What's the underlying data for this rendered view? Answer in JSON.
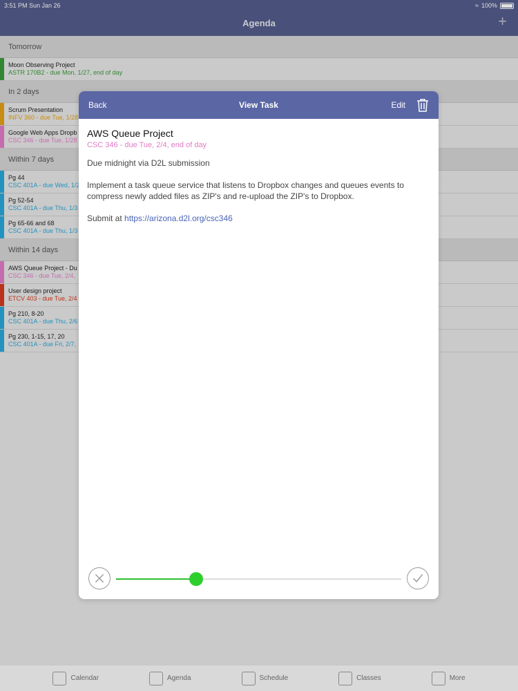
{
  "status": {
    "time": "3:51 PM  Sun Jan 26",
    "battery": "100%"
  },
  "nav": {
    "title": "Agenda",
    "add_label": "+"
  },
  "list": {
    "sections": [
      {
        "title": "Tomorrow",
        "items": [
          {
            "title": "Moon Observing Project",
            "sub": "ASTR 170B2 - due Mon, 1/27, end of day",
            "color": "#3a9b3a"
          }
        ]
      },
      {
        "title": "In 2 days",
        "items": [
          {
            "title": "Scrum Presentation",
            "sub": "INFV 360 - due Tue, 1/28",
            "color": "#e3a016"
          },
          {
            "title": "Google Web Apps Dropb",
            "sub": "CSC 346 - due Tue, 1/28",
            "color": "#e07bc6"
          }
        ]
      },
      {
        "title": "Within 7 days",
        "items": [
          {
            "title": "Pg 44",
            "sub": "CSC 401A - due Wed, 1/2",
            "color": "#2aa7d9"
          },
          {
            "title": "Pg 52-54",
            "sub": "CSC 401A - due Thu, 1/3",
            "color": "#2aa7d9"
          },
          {
            "title": "Pg 65-66 and 68",
            "sub": "CSC 401A - due Thu, 1/3",
            "color": "#2aa7d9"
          }
        ]
      },
      {
        "title": "Within 14 days",
        "items": [
          {
            "title": "AWS Queue Project - Du",
            "sub": "CSC 346 - due Tue, 2/4,",
            "color": "#e07bc6"
          },
          {
            "title": "User design project",
            "sub": "ETCV 403 - due Tue, 2/4",
            "color": "#d43a1e"
          },
          {
            "title": "Pg 210, 8-20",
            "sub": "CSC 401A - due Thu, 2/6",
            "color": "#2aa7d9"
          },
          {
            "title": "Pg 230, 1-15, 17, 20",
            "sub": "CSC 401A - due Fri, 2/7,",
            "color": "#2aa7d9"
          }
        ]
      }
    ]
  },
  "modal": {
    "back_label": "Back",
    "title": "View Task",
    "edit_label": "Edit",
    "task_title": "AWS Queue Project",
    "task_sub": "CSC 346 - due Tue, 2/4, end of day",
    "line1": "Due midnight via D2L submission",
    "line2": "Implement a task queue service that listens to Dropbox changes and queues events to compress newly added files as ZIP's and re-upload the ZIP's to Dropbox.",
    "submit_prefix": "Submit at ",
    "submit_link": "https://arizona.d2l.org/csc346",
    "progress_fraction": 0.28
  },
  "tabbar": {
    "tabs": [
      {
        "label": "Calendar",
        "icon": "calendar-icon"
      },
      {
        "label": "Agenda",
        "icon": "agenda-icon"
      },
      {
        "label": "Schedule",
        "icon": "schedule-icon"
      },
      {
        "label": "Classes",
        "icon": "classes-icon"
      },
      {
        "label": "More",
        "icon": "more-icon"
      }
    ]
  }
}
